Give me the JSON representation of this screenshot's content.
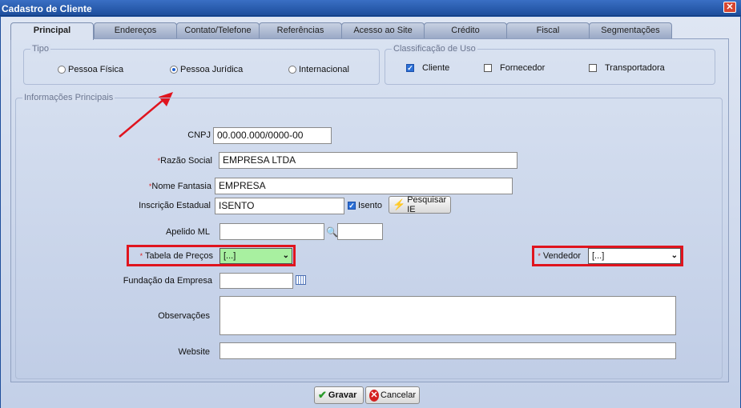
{
  "window": {
    "title": "Cadastro de Cliente",
    "close_glyph": "✕"
  },
  "tabs": [
    {
      "label": "Principal"
    },
    {
      "label": "Endereços"
    },
    {
      "label": "Contato/Telefone"
    },
    {
      "label": "Referências"
    },
    {
      "label": "Acesso ao Site"
    },
    {
      "label": "Crédito"
    },
    {
      "label": "Fiscal"
    },
    {
      "label": "Segmentações"
    }
  ],
  "tipo": {
    "legend": "Tipo",
    "options": [
      {
        "label": "Pessoa Física",
        "selected": false
      },
      {
        "label": "Pessoa Jurídica",
        "selected": true
      },
      {
        "label": "Internacional",
        "selected": false
      }
    ]
  },
  "classificacao": {
    "legend": "Classificação de Uso",
    "options": [
      {
        "label": "Cliente",
        "checked": true
      },
      {
        "label": "Fornecedor",
        "checked": false
      },
      {
        "label": "Transportadora",
        "checked": false
      }
    ]
  },
  "info": {
    "legend": "Informações Principais",
    "required_mark": "*",
    "cnpj": {
      "label": "CNPJ",
      "value": "00.000.000/0000-00"
    },
    "razao_social": {
      "label": "Razão Social",
      "value": "EMPRESA LTDA"
    },
    "nome_fantasia": {
      "label": "Nome Fantasia",
      "value": "EMPRESA"
    },
    "inscricao_estadual": {
      "label": "Inscrição Estadual",
      "value": "ISENTO",
      "isento_label": "Isento",
      "isento_checked": true,
      "pesquisar_label": "Pesquisar IE"
    },
    "apelido_ml": {
      "label": "Apelido ML",
      "value": "",
      "value2": ""
    },
    "tabela_precos": {
      "label": "Tabela de Preços",
      "selected": "[...]",
      "highlight_color": "#a8f0a0"
    },
    "vendedor": {
      "label": "Vendedor",
      "selected": "[...]"
    },
    "fundacao": {
      "label": "Fundação da Empresa",
      "value": ""
    },
    "observacoes": {
      "label": "Observações",
      "value": ""
    },
    "website": {
      "label": "Website",
      "value": ""
    }
  },
  "actions": {
    "gravar_label": "Gravar",
    "cancelar_label": "Cancelar"
  },
  "colors": {
    "highlight_red": "#e0141e",
    "annotation_arrow": "#e0141e",
    "title_blue": "#1d4e9c"
  }
}
